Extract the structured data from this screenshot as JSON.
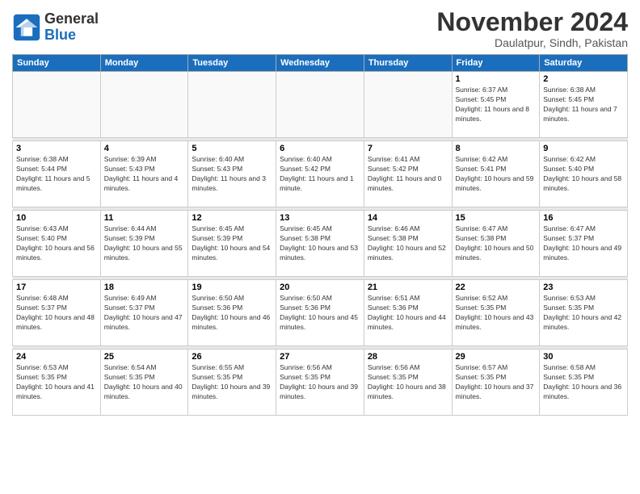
{
  "logo": {
    "name": "General",
    "name2": "Blue"
  },
  "header": {
    "month": "November 2024",
    "location": "Daulatpur, Sindh, Pakistan"
  },
  "weekdays": [
    "Sunday",
    "Monday",
    "Tuesday",
    "Wednesday",
    "Thursday",
    "Friday",
    "Saturday"
  ],
  "weeks": [
    [
      {
        "day": "",
        "info": ""
      },
      {
        "day": "",
        "info": ""
      },
      {
        "day": "",
        "info": ""
      },
      {
        "day": "",
        "info": ""
      },
      {
        "day": "",
        "info": ""
      },
      {
        "day": "1",
        "info": "Sunrise: 6:37 AM\nSunset: 5:45 PM\nDaylight: 11 hours and 8 minutes."
      },
      {
        "day": "2",
        "info": "Sunrise: 6:38 AM\nSunset: 5:45 PM\nDaylight: 11 hours and 7 minutes."
      }
    ],
    [
      {
        "day": "3",
        "info": "Sunrise: 6:38 AM\nSunset: 5:44 PM\nDaylight: 11 hours and 5 minutes."
      },
      {
        "day": "4",
        "info": "Sunrise: 6:39 AM\nSunset: 5:43 PM\nDaylight: 11 hours and 4 minutes."
      },
      {
        "day": "5",
        "info": "Sunrise: 6:40 AM\nSunset: 5:43 PM\nDaylight: 11 hours and 3 minutes."
      },
      {
        "day": "6",
        "info": "Sunrise: 6:40 AM\nSunset: 5:42 PM\nDaylight: 11 hours and 1 minute."
      },
      {
        "day": "7",
        "info": "Sunrise: 6:41 AM\nSunset: 5:42 PM\nDaylight: 11 hours and 0 minutes."
      },
      {
        "day": "8",
        "info": "Sunrise: 6:42 AM\nSunset: 5:41 PM\nDaylight: 10 hours and 59 minutes."
      },
      {
        "day": "9",
        "info": "Sunrise: 6:42 AM\nSunset: 5:40 PM\nDaylight: 10 hours and 58 minutes."
      }
    ],
    [
      {
        "day": "10",
        "info": "Sunrise: 6:43 AM\nSunset: 5:40 PM\nDaylight: 10 hours and 56 minutes."
      },
      {
        "day": "11",
        "info": "Sunrise: 6:44 AM\nSunset: 5:39 PM\nDaylight: 10 hours and 55 minutes."
      },
      {
        "day": "12",
        "info": "Sunrise: 6:45 AM\nSunset: 5:39 PM\nDaylight: 10 hours and 54 minutes."
      },
      {
        "day": "13",
        "info": "Sunrise: 6:45 AM\nSunset: 5:38 PM\nDaylight: 10 hours and 53 minutes."
      },
      {
        "day": "14",
        "info": "Sunrise: 6:46 AM\nSunset: 5:38 PM\nDaylight: 10 hours and 52 minutes."
      },
      {
        "day": "15",
        "info": "Sunrise: 6:47 AM\nSunset: 5:38 PM\nDaylight: 10 hours and 50 minutes."
      },
      {
        "day": "16",
        "info": "Sunrise: 6:47 AM\nSunset: 5:37 PM\nDaylight: 10 hours and 49 minutes."
      }
    ],
    [
      {
        "day": "17",
        "info": "Sunrise: 6:48 AM\nSunset: 5:37 PM\nDaylight: 10 hours and 48 minutes."
      },
      {
        "day": "18",
        "info": "Sunrise: 6:49 AM\nSunset: 5:37 PM\nDaylight: 10 hours and 47 minutes."
      },
      {
        "day": "19",
        "info": "Sunrise: 6:50 AM\nSunset: 5:36 PM\nDaylight: 10 hours and 46 minutes."
      },
      {
        "day": "20",
        "info": "Sunrise: 6:50 AM\nSunset: 5:36 PM\nDaylight: 10 hours and 45 minutes."
      },
      {
        "day": "21",
        "info": "Sunrise: 6:51 AM\nSunset: 5:36 PM\nDaylight: 10 hours and 44 minutes."
      },
      {
        "day": "22",
        "info": "Sunrise: 6:52 AM\nSunset: 5:35 PM\nDaylight: 10 hours and 43 minutes."
      },
      {
        "day": "23",
        "info": "Sunrise: 6:53 AM\nSunset: 5:35 PM\nDaylight: 10 hours and 42 minutes."
      }
    ],
    [
      {
        "day": "24",
        "info": "Sunrise: 6:53 AM\nSunset: 5:35 PM\nDaylight: 10 hours and 41 minutes."
      },
      {
        "day": "25",
        "info": "Sunrise: 6:54 AM\nSunset: 5:35 PM\nDaylight: 10 hours and 40 minutes."
      },
      {
        "day": "26",
        "info": "Sunrise: 6:55 AM\nSunset: 5:35 PM\nDaylight: 10 hours and 39 minutes."
      },
      {
        "day": "27",
        "info": "Sunrise: 6:56 AM\nSunset: 5:35 PM\nDaylight: 10 hours and 39 minutes."
      },
      {
        "day": "28",
        "info": "Sunrise: 6:56 AM\nSunset: 5:35 PM\nDaylight: 10 hours and 38 minutes."
      },
      {
        "day": "29",
        "info": "Sunrise: 6:57 AM\nSunset: 5:35 PM\nDaylight: 10 hours and 37 minutes."
      },
      {
        "day": "30",
        "info": "Sunrise: 6:58 AM\nSunset: 5:35 PM\nDaylight: 10 hours and 36 minutes."
      }
    ]
  ]
}
